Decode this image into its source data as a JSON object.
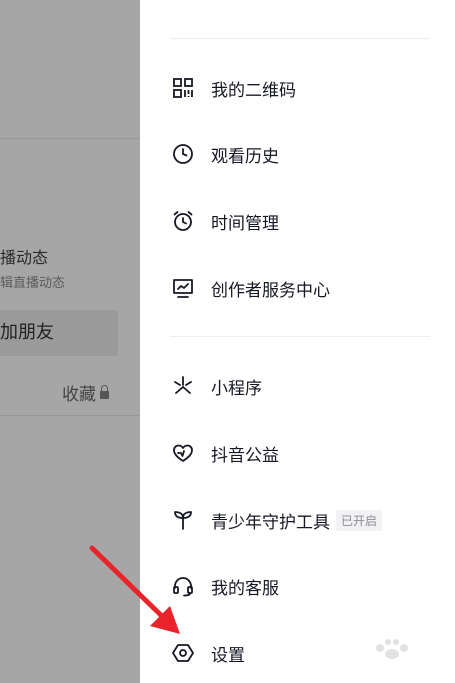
{
  "background": {
    "live_title": "直播动态",
    "live_subtitle": "辑直播动态",
    "add_friend": "加朋友",
    "favorites": "收藏",
    "left_fragment": ""
  },
  "drawer": {
    "items": [
      {
        "label": "我的二维码",
        "icon": "qr-code-icon"
      },
      {
        "label": "观看历史",
        "icon": "clock-icon"
      },
      {
        "label": "时间管理",
        "icon": "alarm-clock-icon"
      },
      {
        "label": "创作者服务中心",
        "icon": "creator-monitor-icon"
      },
      {
        "label": "小程序",
        "icon": "mini-program-icon"
      },
      {
        "label": "抖音公益",
        "icon": "charity-heart-icon"
      },
      {
        "label": "青少年守护工具",
        "icon": "sprout-icon",
        "badge": "已开启"
      },
      {
        "label": "我的客服",
        "icon": "headset-icon"
      },
      {
        "label": "设置",
        "icon": "settings-hexagon-icon"
      }
    ]
  },
  "colors": {
    "annotation_red": "#e8232a",
    "text_primary": "#161823",
    "backdrop": "#a6a6a6"
  }
}
